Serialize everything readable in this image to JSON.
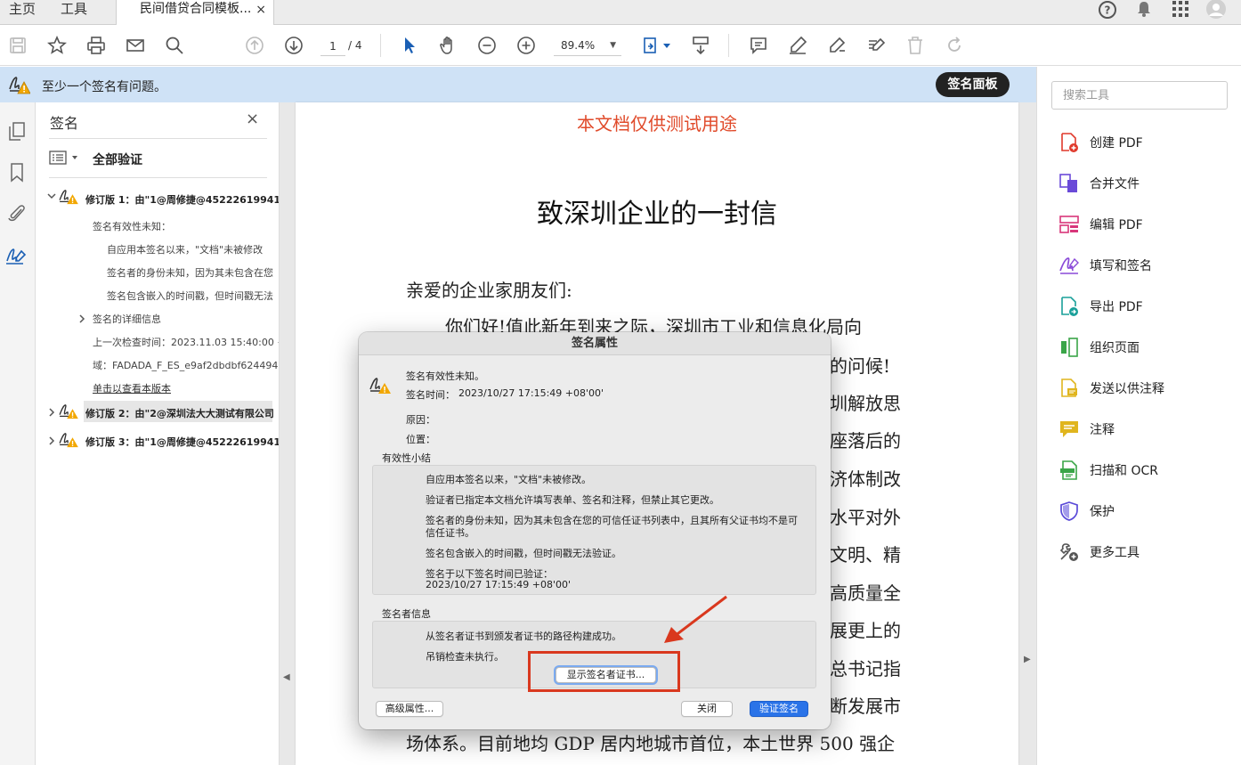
{
  "tabs": {
    "home": "主页",
    "tools": "工具",
    "document": "民间借贷合同模板...",
    "close": "×"
  },
  "toolbar": {
    "page_current": "1",
    "page_total": "/ 4",
    "zoom": "89.4%"
  },
  "notification": {
    "text": "至少一个签名有问题。",
    "button": "签名面板"
  },
  "signature_panel": {
    "title": "签名",
    "close": "×",
    "verify_all": "全部验证",
    "rev1": {
      "title": "修订版 1：由\"1@周修捷@45222619941025",
      "validity": "签名有效性未知：",
      "details": [
        "自应用本签名以来，\"文档\"未被修改",
        "签名者的身份未知，因为其未包含在您",
        "签名包含嵌入的时间戳，但时间戳无法"
      ],
      "detail_info": "签名的详细信息",
      "last_checked": "上一次检查时间：2023.11.03 15:40:00 +0",
      "domain": "域：FADADA_F_ES_e9af2dbdbf6244949f",
      "view_version": "单击以查看本版本"
    },
    "rev2": "修订版 2：由\"2@深圳法大大测试有限公司",
    "rev3": "修订版 3：由\"1@周修捷@45222619941025"
  },
  "document": {
    "watermark": "本文档仅供测试用途",
    "title": "致深圳企业的一封信",
    "greeting": "亲爱的企业家朋友们:",
    "line1": "你们好!值此新年到来之际，深圳市工业和信息化局向",
    "right_fragments": [
      "的问候!",
      "圳解放思",
      "座落后的",
      "济体制改",
      "水平对外",
      "文明、精",
      "高质量全",
      "展更上的",
      "总书记指",
      "断发展市"
    ],
    "last_line": "场体系。目前地均 GDP 居内地城市首位，本土世界 500 强企"
  },
  "tools_panel": {
    "search_placeholder": "搜索工具",
    "items": [
      {
        "label": "创建 PDF",
        "icon": "create-pdf-icon",
        "color": "#e0392b"
      },
      {
        "label": "合并文件",
        "icon": "combine-files-icon",
        "color": "#6a4ad8"
      },
      {
        "label": "编辑 PDF",
        "icon": "edit-pdf-icon",
        "color": "#d8367a"
      },
      {
        "label": "填写和签名",
        "icon": "fill-sign-icon",
        "color": "#8a4ad8"
      },
      {
        "label": "导出 PDF",
        "icon": "export-pdf-icon",
        "color": "#1aa09a"
      },
      {
        "label": "组织页面",
        "icon": "organize-pages-icon",
        "color": "#3aa548"
      },
      {
        "label": "发送以供注释",
        "icon": "send-comment-icon",
        "color": "#e0b51e"
      },
      {
        "label": "注释",
        "icon": "comment-icon",
        "color": "#e0b51e"
      },
      {
        "label": "扫描和 OCR",
        "icon": "scan-ocr-icon",
        "color": "#3aa548"
      },
      {
        "label": "保护",
        "icon": "protect-icon",
        "color": "#5a4ad8"
      },
      {
        "label": "更多工具",
        "icon": "more-tools-icon",
        "color": "#555555"
      }
    ]
  },
  "dialog": {
    "title": "签名属性",
    "validity": "签名有效性未知。",
    "sign_time_label": "签名时间：",
    "sign_time": "2023/10/27 17:15:49 +08'00'",
    "reason_label": "原因：",
    "location_label": "位置：",
    "summary_label": "有效性小结",
    "summary": [
      "自应用本签名以来，\"文档\"未被修改。",
      "验证者已指定本文档允许填写表单、签名和注释，但禁止其它更改。",
      "签名者的身份未知，因为其未包含在您的可信任证书列表中，且其所有父证书均不是可",
      "信任证书。",
      "签名包含嵌入的时间戳，但时间戳无法验证。",
      "签名于以下签名时间已验证：",
      "2023/10/27 17:15:49 +08'00'"
    ],
    "signer_info_label": "签名者信息",
    "signer_info": [
      "从签名者证书到颁发者证书的路径构建成功。",
      "吊销检查未执行。"
    ],
    "show_cert_button": "显示签名者证书...",
    "advanced_button": "高级属性...",
    "close_button": "关闭",
    "verify_button": "验证签名"
  }
}
